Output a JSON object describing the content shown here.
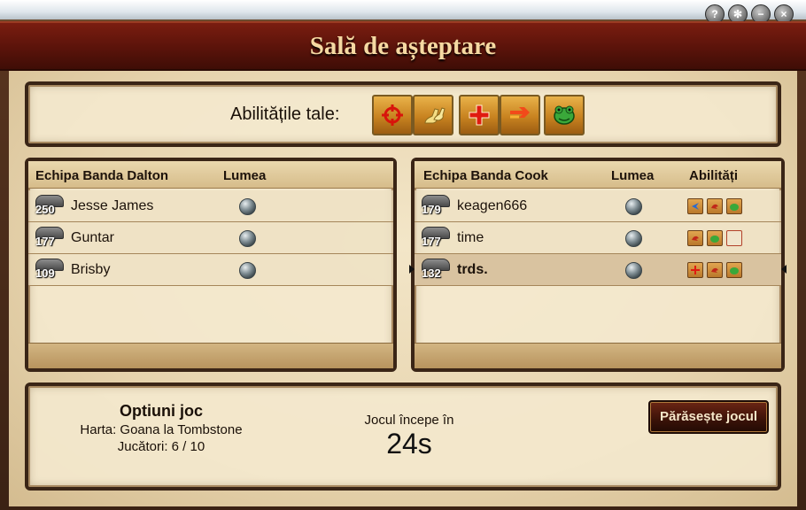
{
  "window": {
    "title": "Sală de așteptare",
    "controls": [
      {
        "name": "help-icon",
        "glyph": "?"
      },
      {
        "name": "settings-icon",
        "glyph": "✻"
      },
      {
        "name": "minimize-icon",
        "glyph": "−"
      },
      {
        "name": "close-icon",
        "glyph": "×"
      }
    ]
  },
  "skills": {
    "label": "Abilitățile tale:",
    "items": [
      "crosshair-icon",
      "boots-icon",
      "health-cross-icon",
      "dash-arrows-icon",
      "frog-icon"
    ]
  },
  "teams": {
    "left": {
      "name_header": "Echipa Banda Dalton",
      "world_header": "Lumea",
      "players": [
        {
          "level": "250",
          "name": "Jesse James",
          "world": "globe-icon"
        },
        {
          "level": "177",
          "name": "Guntar",
          "world": "globe-icon"
        },
        {
          "level": "109",
          "name": "Brisby",
          "world": "globe-icon"
        }
      ]
    },
    "right": {
      "name_header": "Echipa Banda Cook",
      "world_header": "Lumea",
      "skills_header": "Abilități",
      "players": [
        {
          "level": "179",
          "name": "keagen666",
          "world": "globe-icon",
          "skills": [
            "blue-target-icon",
            "red-boot-icon",
            "green-frog-icon"
          ]
        },
        {
          "level": "177",
          "name": "time",
          "world": "globe-icon",
          "skills": [
            "red-boot-icon",
            "green-frog-icon",
            "empty-slot"
          ]
        },
        {
          "level": "132",
          "name": "trds.",
          "world": "globe-icon",
          "skills": [
            "health-cross-icon",
            "red-boot-icon",
            "green-frog-icon"
          ],
          "selected": true
        }
      ]
    }
  },
  "options": {
    "title": "Optiuni joc",
    "map": "Harta: Goana la Tombstone",
    "players": "Jucători: 6 / 10"
  },
  "countdown": {
    "label": "Jocul începe în",
    "value": "24s"
  },
  "leave_button": "Părăsește jocul",
  "colors": {
    "title": "#f6d9a2",
    "titlebar": "#5a130a",
    "skill_tile": "#c88320",
    "parchment": "#efe1c2"
  }
}
